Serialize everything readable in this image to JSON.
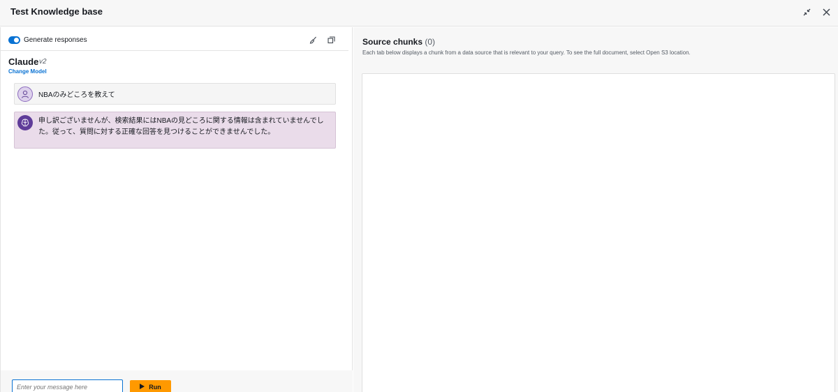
{
  "header": {
    "title": "Test Knowledge base",
    "icons": [
      "collapse-icon",
      "close-icon"
    ]
  },
  "chat": {
    "toggle_label": "Generate responses",
    "toggle_on": true,
    "tool_icons": [
      "clear-brush-icon",
      "copy-icon"
    ],
    "model": {
      "name": "Claude",
      "version": "v2",
      "change_label": "Change Model"
    },
    "messages": [
      {
        "role": "user",
        "text": "NBAのみどころを教えて"
      },
      {
        "role": "assistant",
        "text": "申し訳ございませんが、検索結果にはNBAの見どころに関する情報は含まれていませんでした。従って、質問に対する正確な回答を見つけることができませんでした。"
      }
    ],
    "input_placeholder": "Enter your message here",
    "run_label": "Run"
  },
  "sources": {
    "title": "Source chunks",
    "count": "(0)",
    "description": "Each tab below displays a chunk from a data source that is relevant to your query. To see the full document, select Open S3 location."
  },
  "colors": {
    "accent": "#0972d3",
    "run_button": "#ff9900",
    "assistant_bubble": "#eadcea"
  }
}
